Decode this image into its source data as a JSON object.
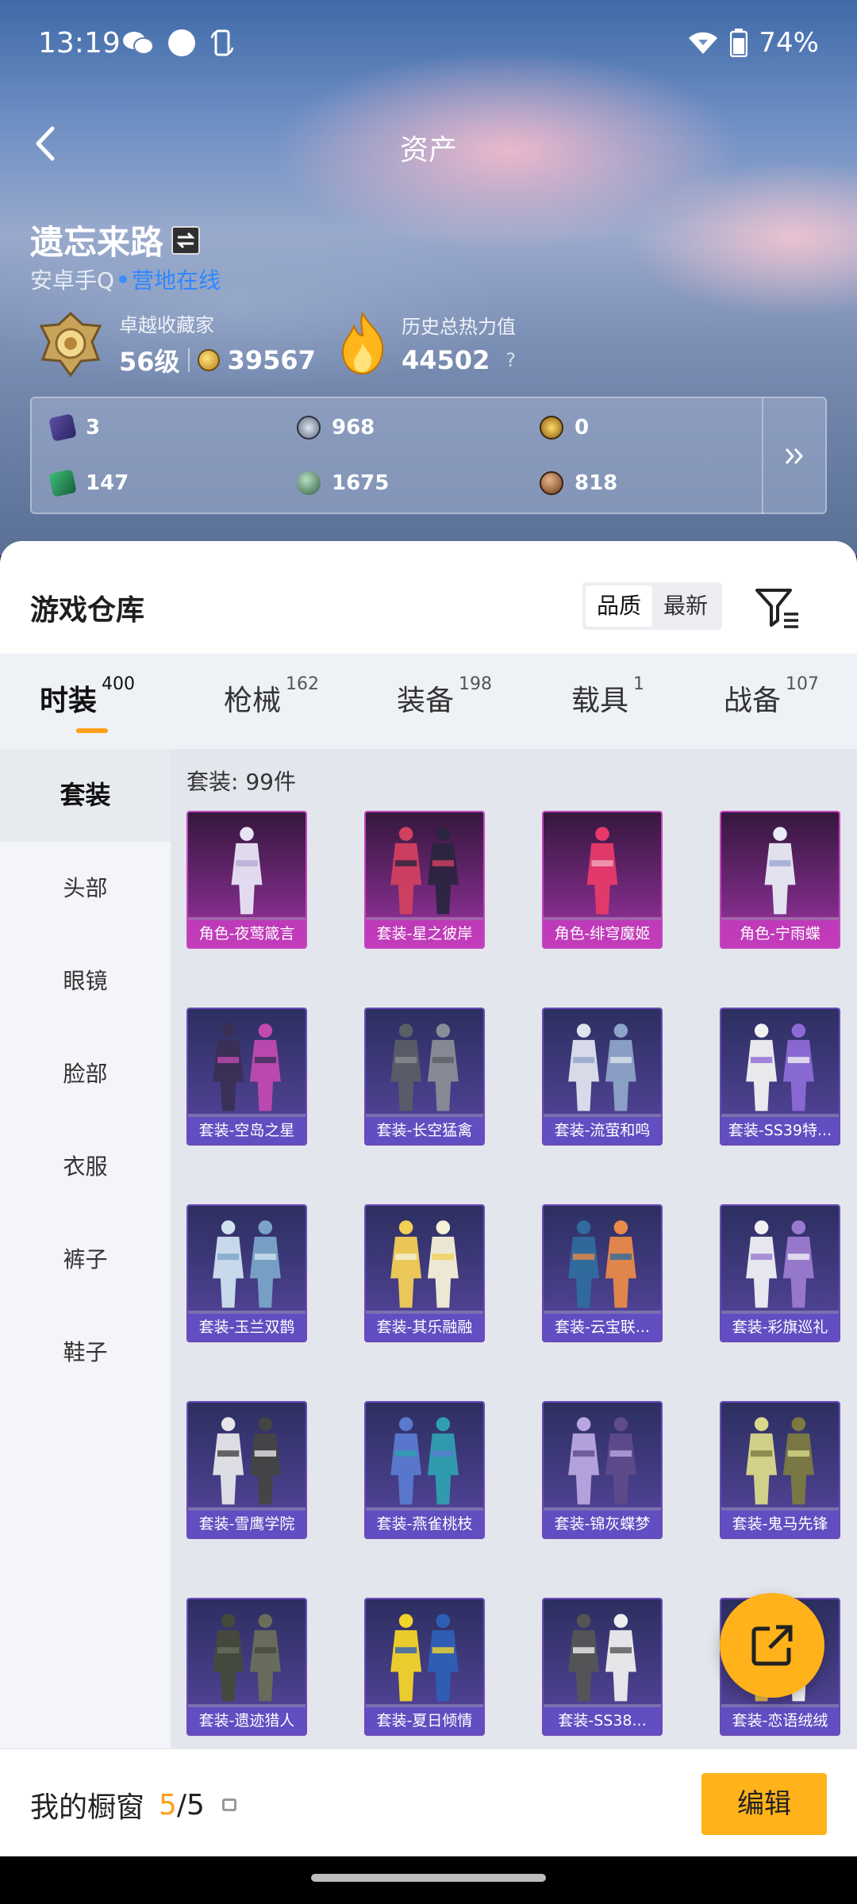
{
  "status_bar": {
    "time": "13:19",
    "battery": "74%",
    "icons_left": [
      "wechat-icon",
      "circle-icon",
      "phone-rotate-icon"
    ],
    "icons_right": [
      "wifi-icon",
      "battery-icon"
    ]
  },
  "header": {
    "title": "资产",
    "back_icon": "back-arrow-icon"
  },
  "profile": {
    "username": "遗忘来路",
    "platform": "安卓手Q",
    "status": "营地在线",
    "rank_title": "卓越收藏家",
    "level": "56级",
    "collection_points": "39567",
    "heat_label": "历史总热力值",
    "heat_value": "44502",
    "help": "?"
  },
  "currencies": [
    {
      "icon": "card-icon",
      "value": "3"
    },
    {
      "icon": "silver-coin-icon",
      "value": "968"
    },
    {
      "icon": "gold-badge-icon",
      "value": "0"
    },
    {
      "icon": "green-card-icon",
      "value": "147"
    },
    {
      "icon": "green-orb-icon",
      "value": "1675"
    },
    {
      "icon": "bronze-coin-icon",
      "value": "818"
    }
  ],
  "warehouse": {
    "title": "游戏仓库",
    "sort_quality": "品质",
    "sort_latest": "最新",
    "filter_icon": "filter-icon"
  },
  "tabs": [
    {
      "label": "时装",
      "count": "400",
      "active": true
    },
    {
      "label": "枪械",
      "count": "162"
    },
    {
      "label": "装备",
      "count": "198"
    },
    {
      "label": "载具",
      "count": "1"
    },
    {
      "label": "战备",
      "count": "107"
    }
  ],
  "side_menu": [
    "套装",
    "头部",
    "眼镜",
    "脸部",
    "衣服",
    "裤子",
    "鞋子"
  ],
  "grid": {
    "count_text": "套装: 99件",
    "items": [
      {
        "label": "角色-夜莺箴言",
        "rarity": "legendary"
      },
      {
        "label": "套装-星之彼岸",
        "rarity": "legendary"
      },
      {
        "label": "角色-绯穹魔姬",
        "rarity": "legendary"
      },
      {
        "label": "角色-宁雨蝶",
        "rarity": "legendary"
      },
      {
        "label": "套装-空岛之星",
        "rarity": "epic"
      },
      {
        "label": "套装-长空猛禽",
        "rarity": "epic"
      },
      {
        "label": "套装-流萤和鸣",
        "rarity": "epic"
      },
      {
        "label": "套装-SS39特...",
        "rarity": "epic"
      },
      {
        "label": "套装-玉兰双鹊",
        "rarity": "epic"
      },
      {
        "label": "套装-其乐融融",
        "rarity": "epic"
      },
      {
        "label": "套装-云宝联...",
        "rarity": "epic"
      },
      {
        "label": "套装-彩旗巡礼",
        "rarity": "epic"
      },
      {
        "label": "套装-雪鹰学院",
        "rarity": "epic"
      },
      {
        "label": "套装-燕雀桃枝",
        "rarity": "epic"
      },
      {
        "label": "套装-锦灰蝶梦",
        "rarity": "epic"
      },
      {
        "label": "套装-鬼马先锋",
        "rarity": "epic"
      },
      {
        "label": "套装-遗迹猎人",
        "rarity": "epic"
      },
      {
        "label": "套装-夏日倾情",
        "rarity": "epic"
      },
      {
        "label": "套装-SS38...",
        "rarity": "epic"
      },
      {
        "label": "套装-恋语绒绒",
        "rarity": "epic"
      }
    ]
  },
  "fab_icon": "share-icon",
  "bottom": {
    "showcase_label": "我的橱窗",
    "showcase_used": "5",
    "showcase_total": "/5",
    "edit_label": "编辑"
  },
  "colors": {
    "accent": "#ffb21a",
    "online_blue": "#2f86ff",
    "legendary": "#c545c0",
    "epic": "#6a4ab8"
  }
}
